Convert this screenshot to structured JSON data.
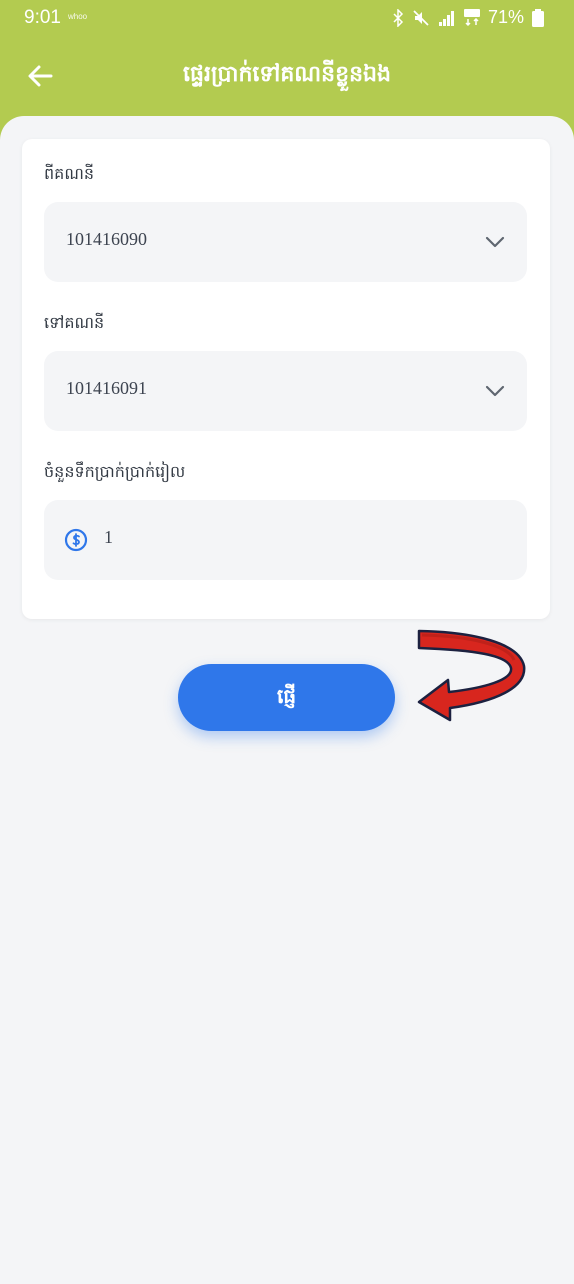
{
  "status_bar": {
    "time": "9:01",
    "carrier_badge": "whoo",
    "battery": "71%",
    "icons": [
      "bluetooth-icon",
      "mute-icon",
      "signal-icon",
      "network-4g-icon",
      "battery-icon"
    ]
  },
  "header": {
    "title": "ផ្ទេរប្រាក់ទៅគណនីខ្លួនឯង",
    "back_icon": "arrow-left-icon"
  },
  "form": {
    "from_account": {
      "label": "ពីគណនី",
      "value": "101416090",
      "icon": "chevron-down-icon"
    },
    "to_account": {
      "label": "ទៅគណនី",
      "value": "101416091",
      "icon": "chevron-down-icon"
    },
    "amount": {
      "label": "ចំនួនទឹកប្រាក់ប្រាក់រៀល",
      "value": "1",
      "icon": "currency-icon"
    }
  },
  "send_button": {
    "label": "ផ្ញើ"
  },
  "colors": {
    "header_bg": "#b3cb50",
    "page_bg": "#f4f5f7",
    "card_bg": "#ffffff",
    "field_bg": "#f4f5f7",
    "button_bg": "#2f77ea",
    "icon_blue": "#2f77ea",
    "annotation_arrow": "#d8261e"
  }
}
